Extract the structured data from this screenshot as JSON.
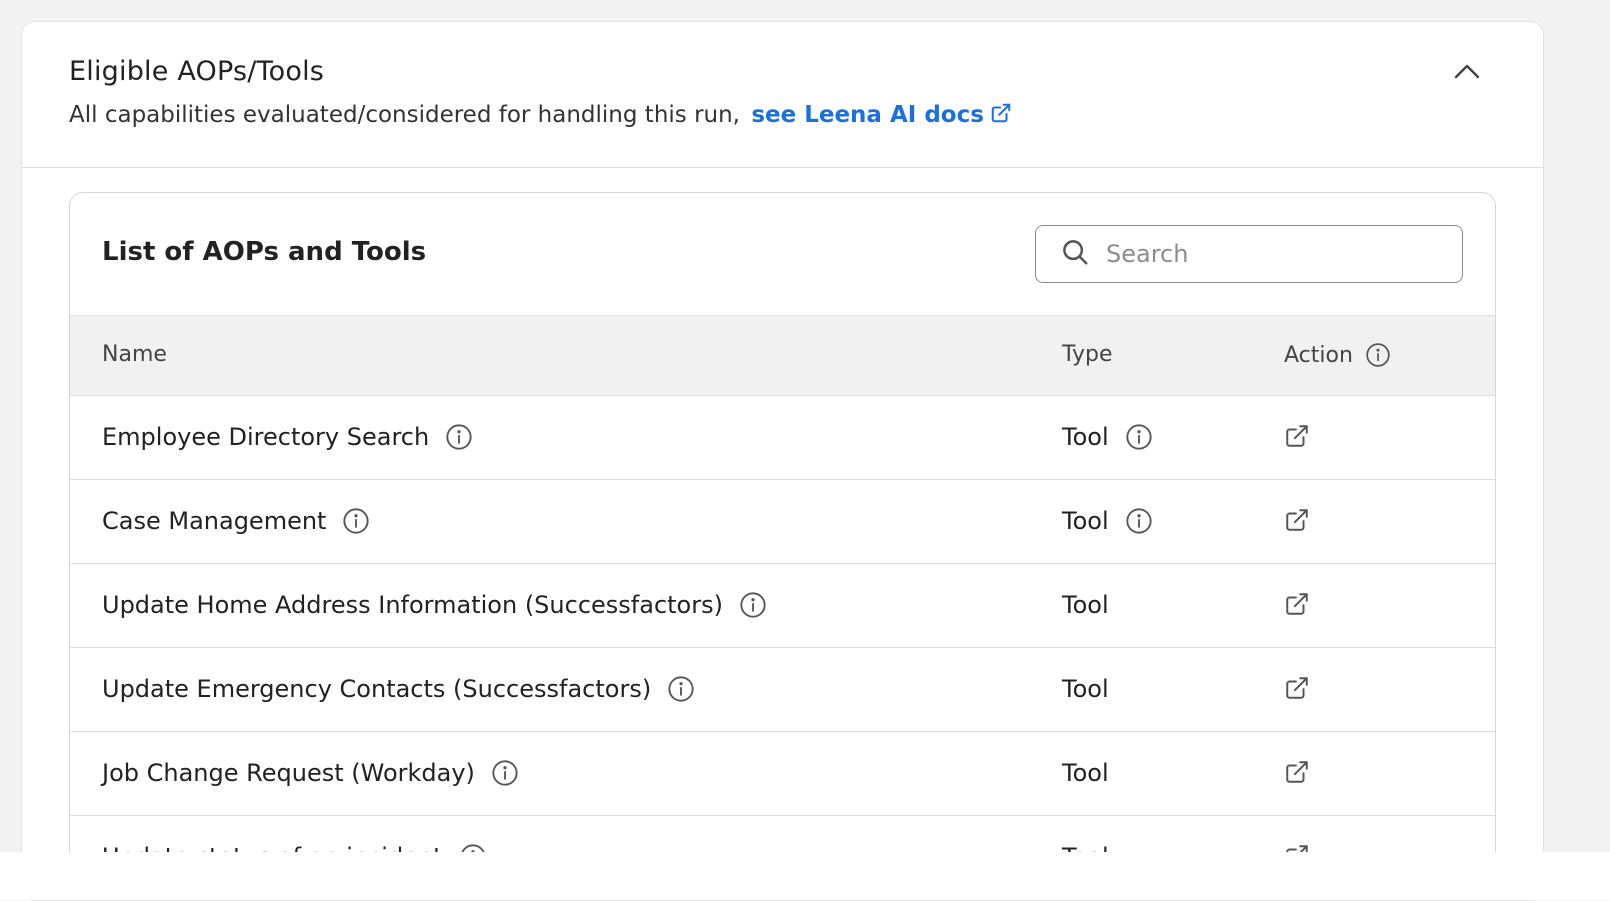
{
  "section": {
    "title": "Eligible AOPs/Tools",
    "subtitle": "All capabilities evaluated/considered for handling this run,",
    "docs_link": "see Leena AI docs"
  },
  "panel": {
    "title": "List of AOPs and Tools",
    "search_placeholder": "Search"
  },
  "table": {
    "columns": {
      "name": "Name",
      "type": "Type",
      "action": "Action"
    },
    "rows": [
      {
        "name": "Employee Directory Search",
        "type": "Tool",
        "type_info": true
      },
      {
        "name": "Case Management",
        "type": "Tool",
        "type_info": true
      },
      {
        "name": "Update Home Address Information (Successfactors)",
        "type": "Tool",
        "type_info": false
      },
      {
        "name": "Update Emergency Contacts (Successfactors)",
        "type": "Tool",
        "type_info": false
      },
      {
        "name": "Job Change Request (Workday)",
        "type": "Tool",
        "type_info": false
      },
      {
        "name": "Update status of an incident",
        "type": "Tool",
        "type_info": false
      }
    ]
  },
  "colors": {
    "link": "#1f6fd8",
    "header_bg": "#f1f1f1",
    "border": "#dedede"
  }
}
